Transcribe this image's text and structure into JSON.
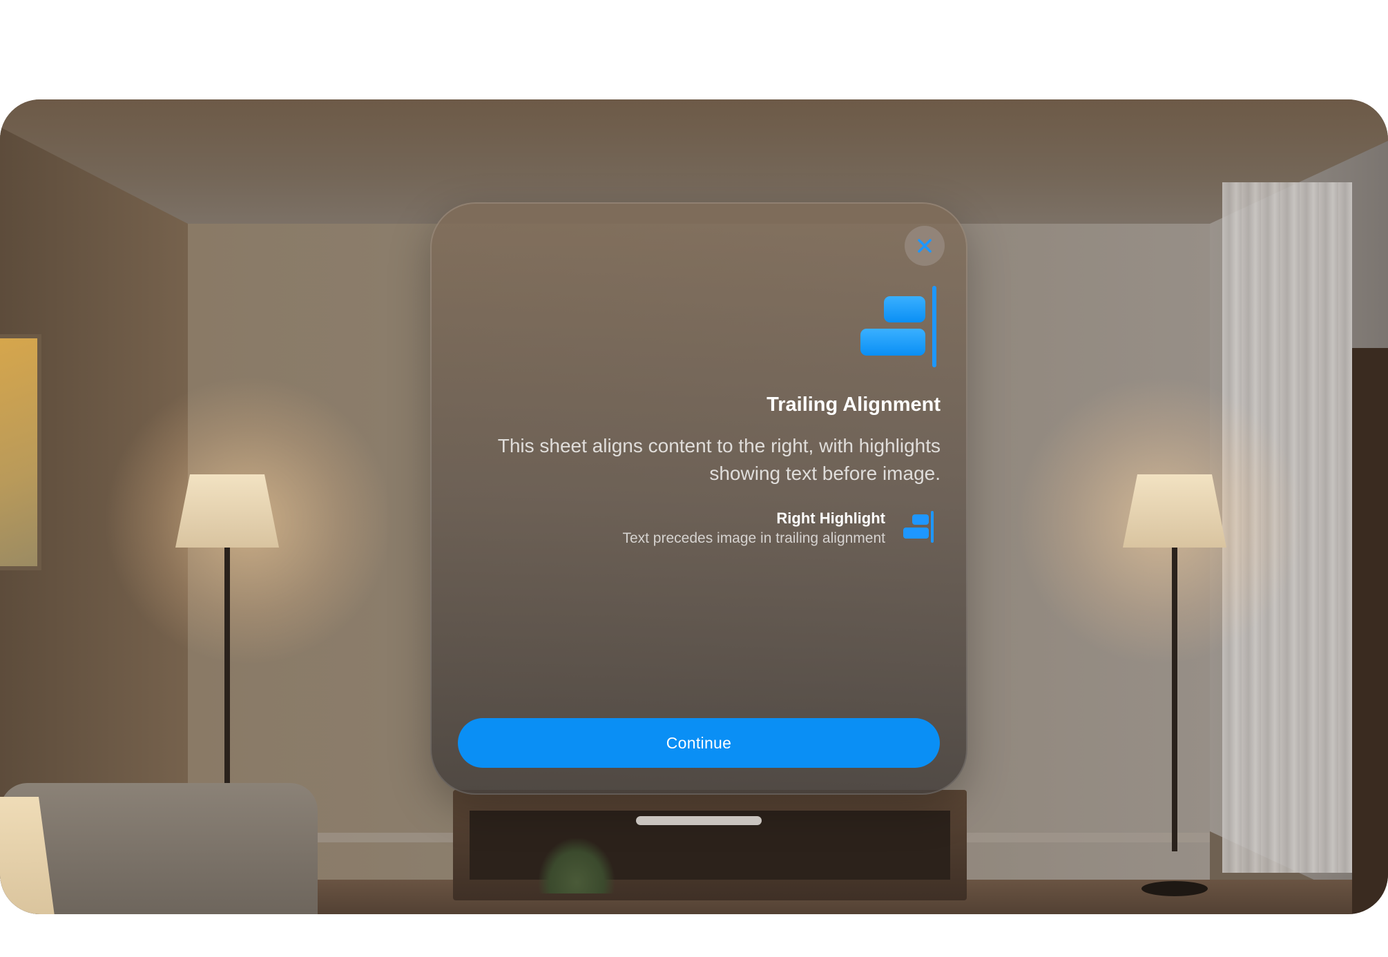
{
  "colors": {
    "accent": "#0a8ff5",
    "icon_blue": "#1e97ff",
    "title_text": "#ffffff"
  },
  "sheet": {
    "close_icon": "xmark-icon",
    "hero_icon": "align-trailing-icon",
    "title": "Trailing Alignment",
    "description": "This sheet aligns content to the right, with highlights showing text before image.",
    "highlight": {
      "title": "Right Highlight",
      "subtitle": "Text precedes image in trailing alignment",
      "icon": "align-trailing-icon"
    },
    "continue_label": "Continue"
  }
}
